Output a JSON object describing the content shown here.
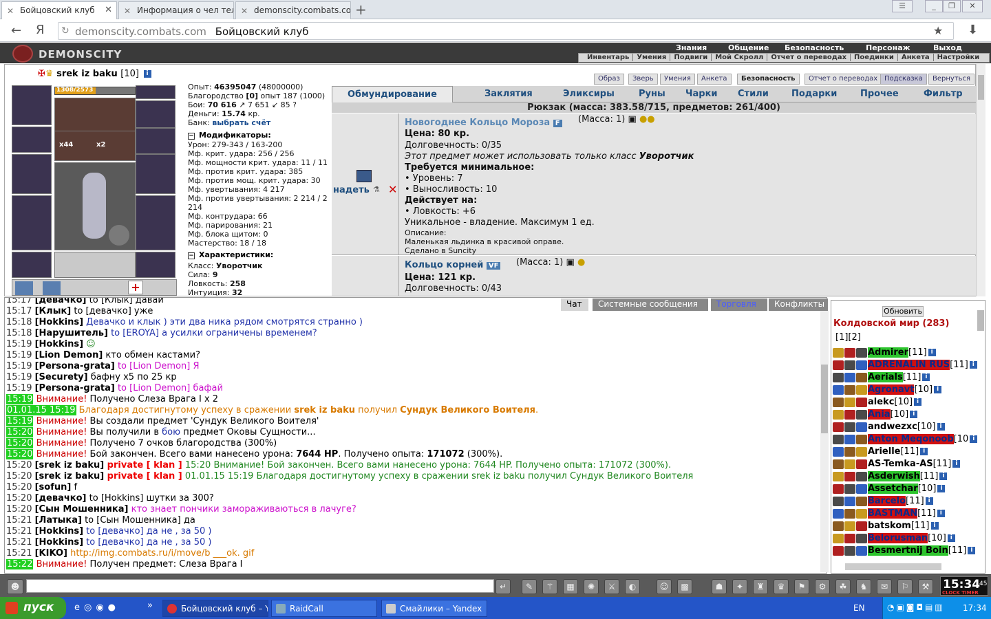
{
  "browser": {
    "tabs": [
      {
        "title": "Бойцовский клуб",
        "active": true
      },
      {
        "title": "Информация о чел тел",
        "active": false
      },
      {
        "title": "demonscity.combats.com/",
        "active": false
      }
    ],
    "new_tab": "+",
    "url_domain": "demonscity.combats.com",
    "url_title": "Бойцовский клуб",
    "back": "←",
    "yandex": "Я",
    "refresh": "↻",
    "star": "★",
    "download": "⬇"
  },
  "game": {
    "logo": "DEMONSCITY",
    "topnav": [
      "Знания",
      "Общение",
      "Безопасность",
      "Персонаж",
      "Выход"
    ],
    "subnav": [
      "Инвентарь",
      "Умения",
      "Подвиги",
      "Мой Скролл",
      "Отчет о переводах",
      "Поединки",
      "Анкета",
      "Настройки"
    ]
  },
  "character": {
    "name": "srek iz baku",
    "level": "[10]",
    "hp": "1308/2573",
    "stats": [
      {
        "label": "Опыт: ",
        "value": "46395047",
        "extra": " (48000000)"
      },
      {
        "label": "Благородство ",
        "value": "[0]",
        "extra": " опыт 187 (1000)"
      },
      {
        "label": "Бои:  ",
        "value": "70 616",
        "extra": " ↗  7 651 ↙  85 ?"
      },
      {
        "label": "Деньги: ",
        "value": "15.74",
        "extra": " кр."
      }
    ],
    "bank_label": "Банк: ",
    "bank_link": "выбрать счёт",
    "mods_title": "Модификаторы:",
    "mods": [
      "Урон: 279-343 / 163-200",
      "Мф. крит. удара: 256 / 256",
      "Мф. мощности крит. удара: 11 / 11",
      "Мф. против крит. удара: 385",
      "Мф. против мощ. крит. удара: 30",
      "Мф. увертывания: 4 217",
      "Мф. против увертывания: 2 214 / 2",
      "214",
      "Мф. контрудара: 66",
      "Мф. парирования: 21",
      "Мф. блока щитом: 0",
      "Мастерство: 18 / 18"
    ],
    "chars_title": "Характеристики:",
    "chars": [
      {
        "label": "Класс: ",
        "value": "Уворотчик"
      },
      {
        "label": "Сила: ",
        "value": "9"
      },
      {
        "label": "Ловкость: ",
        "value": "258"
      },
      {
        "label": "Интуиция: ",
        "value": "32"
      }
    ],
    "slot_counts": {
      "a": "x44",
      "b": "x2"
    }
  },
  "panel": {
    "buttons": [
      "Образ",
      "Зверь",
      "Умения",
      "Анкета",
      "Безопасность",
      "Отчет о переводах",
      "Подсказка",
      "Вернуться"
    ],
    "tabs": [
      "Обмундирование",
      "Заклятия",
      "Эликсиры",
      "Руны",
      "Чарки",
      "Стили",
      "Подарки",
      "Прочее",
      "Фильтр"
    ],
    "backpack": "Рюкзак (масса: 383.58/715, предметов: 261/400)",
    "wear": "надеть",
    "items": [
      {
        "name": "Новогоднее Кольцо Мороза",
        "badge": "F",
        "mass": "(Масса: 1)",
        "price": "Цена: 80 кр.",
        "durability": "Долговечность: 0/35",
        "class_note": "Этот предмет может использовать только класс ",
        "class_name": "Уворотчик",
        "req_title": "Требуется минимальное:",
        "req": [
          "• Уровень: 7",
          "• Выносливость: 10"
        ],
        "act_title": "Действует на:",
        "act": [
          "• Ловкость: +6"
        ],
        "unique": "Уникальное - владение. Максимум 1 ед.",
        "desc_title": "Описание:",
        "desc": "Маленькая льдинка в красивой оправе.",
        "made": "Сделано в Suncity"
      },
      {
        "name": "Кольцо корней",
        "badge": "VF",
        "mass": "(Масса: 1)",
        "price": "Цена: 121 кр.",
        "durability": "Долговечность: 0/43"
      }
    ]
  },
  "chat": {
    "tabs": [
      "Чат",
      "Системные сообщения",
      "Торговля",
      "Конфликты"
    ],
    "lines": [
      {
        "t": "15:17",
        "g": false,
        "segs": [
          {
            "c": "nick",
            "v": "[девачко]"
          },
          {
            "c": "",
            "v": " to [Клык] давай"
          }
        ]
      },
      {
        "t": "15:17",
        "g": false,
        "segs": [
          {
            "c": "nick",
            "v": "[Клык]"
          },
          {
            "c": "",
            "v": " to [девачко] уже"
          }
        ]
      },
      {
        "t": "15:18",
        "g": false,
        "segs": [
          {
            "c": "nick",
            "v": "[Hokkins]"
          },
          {
            "c": "col-blue",
            "v": " Девачко и клык ) эти два ника рядом смотрятся странно )"
          }
        ]
      },
      {
        "t": "15:18",
        "g": false,
        "segs": [
          {
            "c": "nick",
            "v": "[Нарушитель]"
          },
          {
            "c": "col-blue",
            "v": " to [EROYA] а усилки ограничены временем?"
          }
        ]
      },
      {
        "t": "15:19",
        "g": false,
        "segs": [
          {
            "c": "nick",
            "v": "[Hokkins]"
          },
          {
            "c": "col-grn",
            "v": " ☺"
          }
        ]
      },
      {
        "t": "15:19",
        "g": false,
        "segs": [
          {
            "c": "nick",
            "v": "[Lion Demon]"
          },
          {
            "c": "",
            "v": " кто обмен кастами?"
          }
        ]
      },
      {
        "t": "15:19",
        "g": false,
        "segs": [
          {
            "c": "nick",
            "v": "[Persona-grata]"
          },
          {
            "c": "col-mag",
            "v": " to [Lion Demon] Я"
          }
        ]
      },
      {
        "t": "15:19",
        "g": false,
        "segs": [
          {
            "c": "nick",
            "v": "[Securety]"
          },
          {
            "c": "",
            "v": " бафну х5 по 25 кр"
          }
        ]
      },
      {
        "t": "15:19",
        "g": false,
        "segs": [
          {
            "c": "nick",
            "v": "[Persona-grata]"
          },
          {
            "c": "col-mag",
            "v": " to [Lion Demon] бафай"
          }
        ]
      },
      {
        "t": "15:19",
        "g": true,
        "segs": [
          {
            "c": "col-red",
            "v": "Внимание!"
          },
          {
            "c": "",
            "v": " Получено Слеза Врага I x 2"
          }
        ]
      },
      {
        "t": "01.01.15 15:19",
        "g": true,
        "segs": [
          {
            "c": "col-org",
            "v": " Благодаря достигнутому успеху в сражении "
          },
          {
            "c": "col-org b",
            "v": "srek iz baku"
          },
          {
            "c": "col-org",
            "v": " получил "
          },
          {
            "c": "col-org b",
            "v": "Сундук Великого Воителя"
          },
          {
            "c": "col-org",
            "v": "."
          }
        ]
      },
      {
        "t": "15:19",
        "g": true,
        "segs": [
          {
            "c": "col-red",
            "v": "Внимание!"
          },
          {
            "c": "",
            "v": " Вы создали предмет 'Сундук Великого Воителя'"
          }
        ]
      },
      {
        "t": "15:20",
        "g": true,
        "segs": [
          {
            "c": "col-red",
            "v": "Внимание!"
          },
          {
            "c": "",
            "v": " Вы получили в "
          },
          {
            "c": "col-blue",
            "v": "бою"
          },
          {
            "c": "",
            "v": " предмет Оковы Сущности..."
          }
        ]
      },
      {
        "t": "15:20",
        "g": true,
        "segs": [
          {
            "c": "col-red",
            "v": "Внимание!"
          },
          {
            "c": "",
            "v": " Получено 7 очков благородства (300%)"
          }
        ]
      },
      {
        "t": "15:20",
        "g": true,
        "segs": [
          {
            "c": "col-red",
            "v": "Внимание!"
          },
          {
            "c": "",
            "v": " Бой закончен. Всего вами нанесено урона: "
          },
          {
            "c": "b",
            "v": "7644 HP"
          },
          {
            "c": "",
            "v": ". Получено опыта: "
          },
          {
            "c": "b",
            "v": "171072"
          },
          {
            "c": "",
            "v": " (300%)."
          }
        ]
      },
      {
        "t": "15:20",
        "g": false,
        "segs": [
          {
            "c": "nick",
            "v": "[srek iz baku]"
          },
          {
            "c": "col-pr",
            "v": " private [ klan ]"
          },
          {
            "c": "col-grn",
            "v": " 15:20 Внимание! Бой закончен. Всего вами нанесено урона: 7644 HP. Получено опыта: 171072 (300%)."
          }
        ]
      },
      {
        "t": "15:20",
        "g": false,
        "segs": [
          {
            "c": "nick",
            "v": "[srek iz baku]"
          },
          {
            "c": "col-pr",
            "v": " private [ klan ]"
          },
          {
            "c": "col-grn",
            "v": " 01.01.15 15:19 Благодаря достигнутому успеху в сражении srek iz baku получил Сундук Великого Воителя"
          }
        ]
      },
      {
        "t": "15:20",
        "g": false,
        "segs": [
          {
            "c": "nick",
            "v": "[sofun]"
          },
          {
            "c": "",
            "v": " f"
          }
        ]
      },
      {
        "t": "15:20",
        "g": false,
        "segs": [
          {
            "c": "nick",
            "v": "[девачко]"
          },
          {
            "c": "",
            "v": " to [Hokkins] шутки за 300?"
          }
        ]
      },
      {
        "t": "15:20",
        "g": false,
        "segs": [
          {
            "c": "nick",
            "v": "[Сын Мошенника]"
          },
          {
            "c": "col-mag",
            "v": " кто знает пончики замораживаються в лачуге?"
          }
        ]
      },
      {
        "t": "15:21",
        "g": false,
        "segs": [
          {
            "c": "nick",
            "v": "[Латыка]"
          },
          {
            "c": "",
            "v": " to [Сын Мошенника] да"
          }
        ]
      },
      {
        "t": "15:21",
        "g": false,
        "segs": [
          {
            "c": "nick",
            "v": "[Hokkins]"
          },
          {
            "c": "col-blue",
            "v": " to [девачко] да не , за 50 )"
          }
        ]
      },
      {
        "t": "15:21",
        "g": false,
        "segs": [
          {
            "c": "nick",
            "v": "[Hokkins]"
          },
          {
            "c": "col-blue",
            "v": " to [девачко] да не , за 50 )"
          }
        ]
      },
      {
        "t": "15:21",
        "g": false,
        "segs": [
          {
            "c": "nick",
            "v": "[KIKO]"
          },
          {
            "c": "col-org",
            "v": " http://img.combats.ru/i/move/b ___ok. gif"
          }
        ]
      },
      {
        "t": "15:22",
        "g": true,
        "segs": [
          {
            "c": "col-red",
            "v": "Внимание!"
          },
          {
            "c": "",
            "v": " Получен предмет: Слеза Врага I"
          }
        ]
      }
    ]
  },
  "userlist": {
    "refresh": "Обновить",
    "title": "Колдовской мир (283)",
    "pages": "[1][2]",
    "users": [
      {
        "name": "Admirer",
        "lvl": "[11]",
        "style": "nm-grn"
      },
      {
        "name": "ADRENALIN RUS",
        "lvl": "[11]",
        "style": "nm-red"
      },
      {
        "name": "Aerials",
        "lvl": "[11]",
        "style": "nm-grn"
      },
      {
        "name": "Agronavt",
        "lvl": "[10]",
        "style": "nm-red"
      },
      {
        "name": "alekc",
        "lvl": "[10]",
        "style": "nm-plain"
      },
      {
        "name": "Ania",
        "lvl": "[10]",
        "style": "nm-red"
      },
      {
        "name": "andwezxc",
        "lvl": "[10]",
        "style": "nm-plain"
      },
      {
        "name": "Anton Meqonoob",
        "lvl": "[10",
        "style": "nm-red"
      },
      {
        "name": "Arielle",
        "lvl": "[11]",
        "style": "nm-plain"
      },
      {
        "name": "AS-Temka-AS",
        "lvl": "[11]",
        "style": "nm-plain"
      },
      {
        "name": "Asderwish",
        "lvl": "[11]",
        "style": "nm-grn"
      },
      {
        "name": "Assetchar",
        "lvl": "[10]",
        "style": "nm-grn"
      },
      {
        "name": "Barcelo",
        "lvl": "[11]",
        "style": "nm-red"
      },
      {
        "name": "BASTMAN",
        "lvl": "[11]",
        "style": "nm-red"
      },
      {
        "name": "batskom",
        "lvl": "[11]",
        "style": "nm-plain"
      },
      {
        "name": "Belorusman",
        "lvl": "[10]",
        "style": "nm-red"
      },
      {
        "name": "Besmertnij Boin",
        "lvl": "[11]",
        "style": "nm-grn"
      }
    ]
  },
  "clock": {
    "time": "15:34",
    "sec": "45",
    "label": "CLOCK TIMER"
  },
  "taskbar": {
    "start": "пуск",
    "tasks": [
      "Бойцовский клуб – Y...",
      "RaidCall",
      "Смайлики – Yandex"
    ],
    "lang": "EN",
    "time": "17:34",
    "more": "»"
  }
}
